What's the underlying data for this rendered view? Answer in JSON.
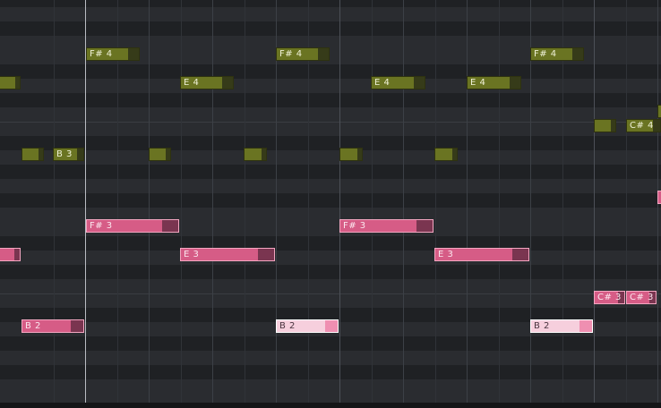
{
  "app": {
    "view": "piano-roll"
  },
  "colors": {
    "background": "#25272b",
    "lane_dark": "#1f2124",
    "lane_light": "#2a2c30",
    "note_olive": "#6a7422",
    "note_pink": "#d65c86",
    "note_pink_selected": "#f6cfdd",
    "playhead": "#b9bcc2"
  },
  "notes": [
    {
      "pitch": "F# 4",
      "label": "F# 4",
      "color": "olive"
    },
    {
      "pitch": "F# 4",
      "label": "F# 4",
      "color": "olive"
    },
    {
      "pitch": "F# 4",
      "label": "F# 4",
      "color": "olive"
    },
    {
      "pitch": "E 4",
      "label": "",
      "color": "olive"
    },
    {
      "pitch": "E 4",
      "label": "E 4",
      "color": "olive"
    },
    {
      "pitch": "E 4",
      "label": "E 4",
      "color": "olive"
    },
    {
      "pitch": "E 4",
      "label": "E 4",
      "color": "olive"
    },
    {
      "pitch": "D 4",
      "label": "",
      "color": "olive"
    },
    {
      "pitch": "C# 4",
      "label": "",
      "color": "olive"
    },
    {
      "pitch": "C# 4",
      "label": "C# 4",
      "color": "olive"
    },
    {
      "pitch": "B 3",
      "label": "",
      "color": "olive"
    },
    {
      "pitch": "B 3",
      "label": "B 3",
      "color": "olive"
    },
    {
      "pitch": "B 3",
      "label": "",
      "color": "olive"
    },
    {
      "pitch": "B 3",
      "label": "",
      "color": "olive"
    },
    {
      "pitch": "B 3",
      "label": "",
      "color": "olive"
    },
    {
      "pitch": "B 3",
      "label": "",
      "color": "olive"
    },
    {
      "pitch": "F# 3",
      "label": "F# 3",
      "color": "pink"
    },
    {
      "pitch": "F# 3",
      "label": "F# 3",
      "color": "pink"
    },
    {
      "pitch": "E 3",
      "label": "",
      "color": "pink"
    },
    {
      "pitch": "E 3",
      "label": "E 3",
      "color": "pink"
    },
    {
      "pitch": "E 3",
      "label": "E 3",
      "color": "pink"
    },
    {
      "pitch": "C# 3",
      "label": "C# 3",
      "color": "pink"
    },
    {
      "pitch": "C# 3",
      "label": "C# 3",
      "color": "pink"
    },
    {
      "pitch": "G# 3",
      "label": "",
      "color": "pink"
    },
    {
      "pitch": "B 2",
      "label": "B 2",
      "color": "pink"
    },
    {
      "pitch": "B 2",
      "label": "B 2",
      "color": "pale"
    },
    {
      "pitch": "B 2",
      "label": "B 2",
      "color": "pale"
    }
  ]
}
